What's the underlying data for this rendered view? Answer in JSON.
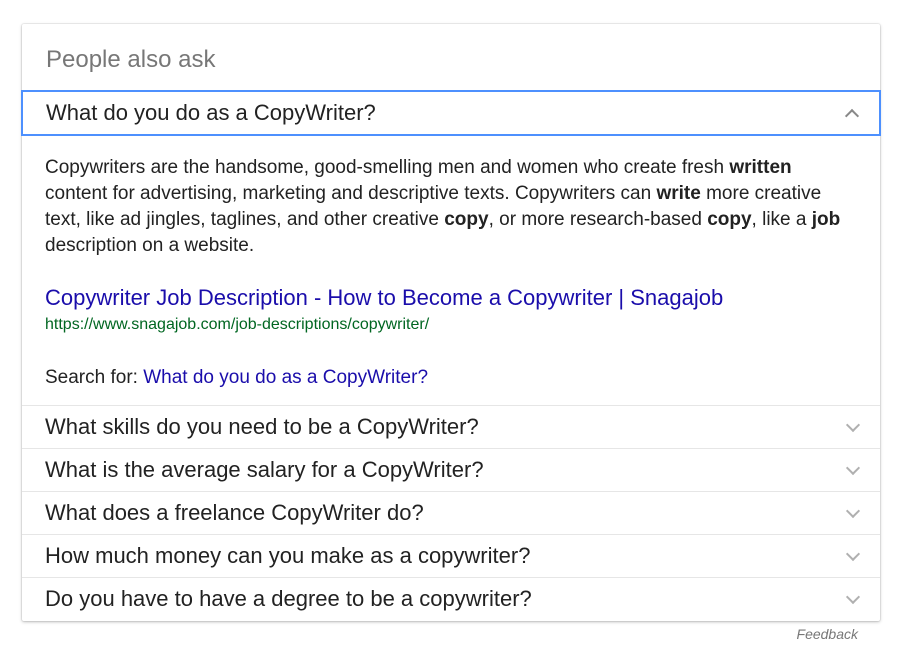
{
  "paa": {
    "title": "People also ask",
    "open_question": "What do you do as a CopyWriter?",
    "answer_segments": [
      {
        "text": "Copywriters are the handsome, good-smelling men and women who create fresh ",
        "bold": false
      },
      {
        "text": "written",
        "bold": true
      },
      {
        "text": " content for advertising, marketing and descriptive texts. Copywriters can ",
        "bold": false
      },
      {
        "text": "write",
        "bold": true
      },
      {
        "text": " more creative text, like ad jingles, taglines, and other creative ",
        "bold": false
      },
      {
        "text": "copy",
        "bold": true
      },
      {
        "text": ", or more research-based ",
        "bold": false
      },
      {
        "text": "copy",
        "bold": true
      },
      {
        "text": ", like a ",
        "bold": false
      },
      {
        "text": "job",
        "bold": true
      },
      {
        "text": " description on a website.",
        "bold": false
      }
    ],
    "result": {
      "title": "Copywriter Job Description - How to Become a Copywriter | Snagajob",
      "url": "https://www.snagajob.com/job-descriptions/copywriter/"
    },
    "search_for": {
      "label": "Search for: ",
      "query": "What do you do as a CopyWriter?"
    },
    "questions": [
      {
        "text": "What skills do you need to be a CopyWriter?"
      },
      {
        "text": "What is the average salary for a CopyWriter?"
      },
      {
        "text": "What does a freelance CopyWriter do?"
      },
      {
        "text": "How much money can you make as a copywriter?"
      },
      {
        "text": "Do you have to have a degree to be a copywriter?"
      }
    ]
  },
  "footer": {
    "feedback_label": "Feedback"
  },
  "colors": {
    "link": "#1a0dab",
    "url": "#006621",
    "focus_border": "#4d90fe",
    "muted": "#777777"
  },
  "icons": {
    "expanded": "chevron-up-icon",
    "collapsed": "chevron-down-icon"
  }
}
